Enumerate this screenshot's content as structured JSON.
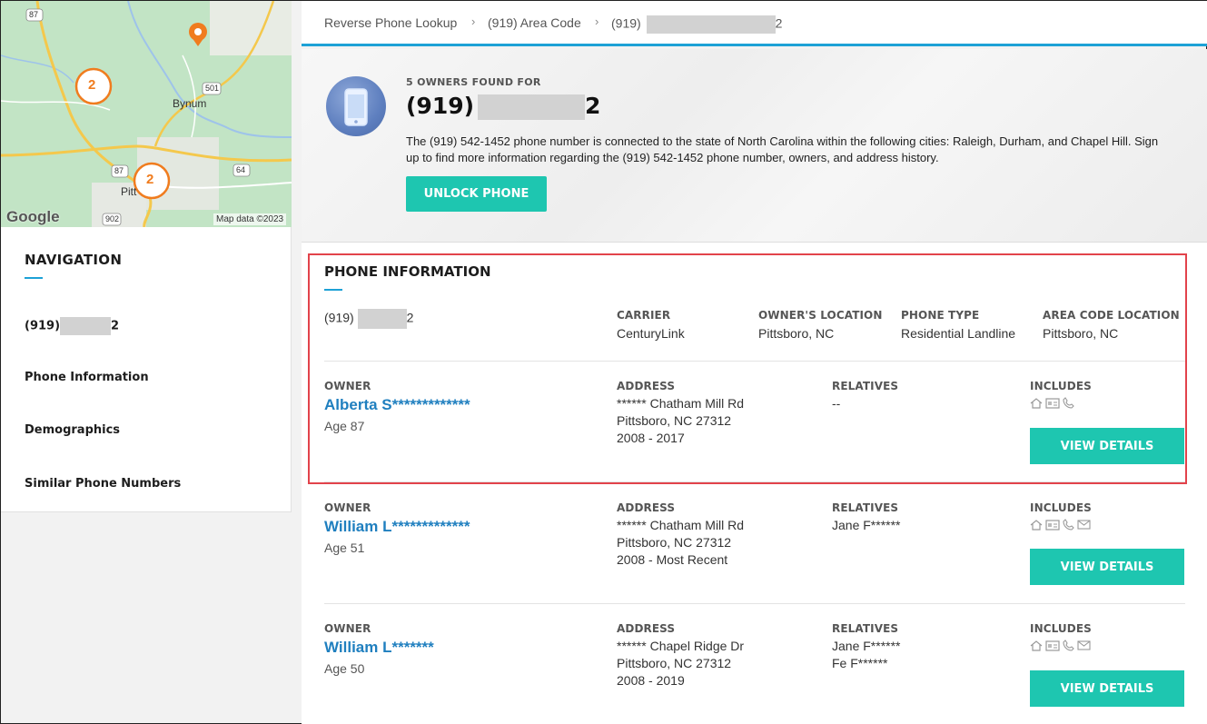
{
  "map": {
    "cluster_labels": [
      "2",
      "2"
    ],
    "road_labels": [
      "87",
      "501",
      "87",
      "64",
      "902"
    ],
    "town_labels": [
      "Bynum",
      "Pitt"
    ],
    "google_logo": "Google",
    "map_data": "Map data ©2023"
  },
  "nav": {
    "title": "NAVIGATION",
    "items": [
      {
        "prefix": "(919)",
        "suffix": "2"
      },
      {
        "label": "Phone Information"
      },
      {
        "label": "Demographics"
      },
      {
        "label": "Similar Phone Numbers"
      }
    ]
  },
  "breadcrumb": {
    "items": [
      "Reverse Phone Lookup",
      "(919) Area Code"
    ],
    "current_prefix": "(919)",
    "current_suffix": "2",
    "separator": "›"
  },
  "hero": {
    "found_label": "5 OWNERS FOUND FOR",
    "number_prefix": "(919)",
    "number_suffix": "2",
    "description": "The (919) 542-1452 phone number is connected to the state of North Carolina within the following cities: Raleigh, Durham, and Chapel Hill. Sign up to find more information regarding the (919) 542-1452 phone number, owners, and address history.",
    "unlock_button": "UNLOCK PHONE"
  },
  "phone_info": {
    "title": "PHONE INFORMATION",
    "number_prefix": "(919)",
    "number_suffix": "2",
    "carrier_label": "CARRIER",
    "carrier": "CenturyLink",
    "owner_location_label": "OWNER'S LOCATION",
    "owner_location": "Pittsboro, NC",
    "phone_type_label": "PHONE TYPE",
    "phone_type": "Residential Landline",
    "area_code_label": "AREA CODE LOCATION",
    "area_code_location": "Pittsboro, NC"
  },
  "labels": {
    "owner": "OWNER",
    "address": "ADDRESS",
    "relatives": "RELATIVES",
    "includes": "INCLUDES",
    "view_details": "VIEW DETAILS"
  },
  "owners": [
    {
      "name": "Alberta S*************",
      "age": "Age 87",
      "address_line1": "****** Chatham Mill Rd",
      "address_line2": "Pittsboro, NC 27312",
      "years": "2008 - 2017",
      "relatives": [
        "--"
      ],
      "includes": [
        "house-icon",
        "id-card-icon",
        "phone-icon"
      ]
    },
    {
      "name": "William L*************",
      "age": "Age 51",
      "address_line1": "****** Chatham Mill Rd",
      "address_line2": "Pittsboro, NC 27312",
      "years": "2008 - Most Recent",
      "relatives": [
        "Jane F******"
      ],
      "includes": [
        "house-icon",
        "id-card-icon",
        "phone-icon",
        "email-icon"
      ]
    },
    {
      "name": "William L*******",
      "age": "Age 50",
      "address_line1": "****** Chapel Ridge Dr",
      "address_line2": "Pittsboro, NC 27312",
      "years": "2008 - 2019",
      "relatives": [
        "Jane F******",
        "Fe F******"
      ],
      "includes": [
        "house-icon",
        "id-card-icon",
        "phone-icon",
        "email-icon"
      ]
    }
  ],
  "colors": {
    "accent_blue": "#1da1d6",
    "button_teal": "#1ec6b0",
    "link_blue": "#1f7fbf",
    "highlight_red": "#e2434b",
    "cluster_orange": "#f07c1e"
  }
}
